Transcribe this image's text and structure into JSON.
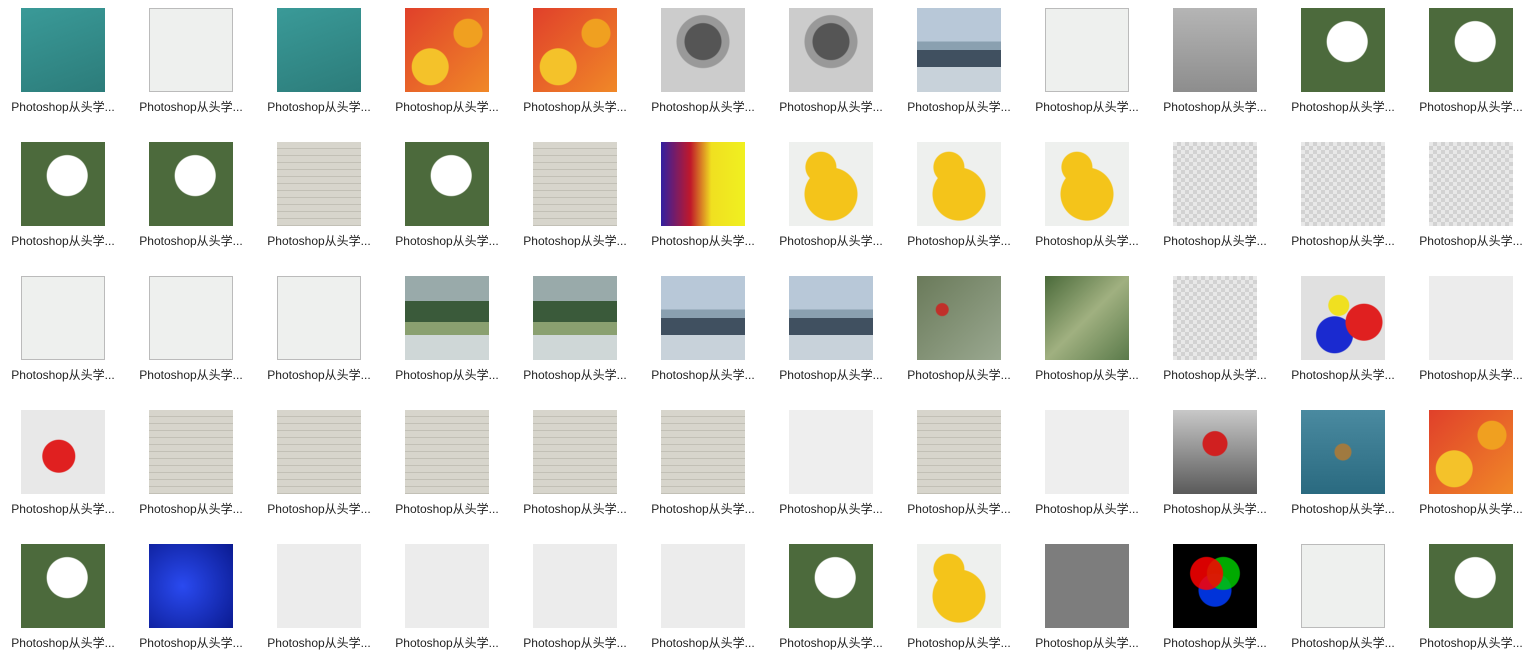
{
  "items": [
    {
      "label": "Photoshop从头学...",
      "thumb": "t-teal"
    },
    {
      "label": "Photoshop从头学...",
      "thumb": "t-white"
    },
    {
      "label": "Photoshop从头学...",
      "thumb": "t-teal"
    },
    {
      "label": "Photoshop从头学...",
      "thumb": "t-flower"
    },
    {
      "label": "Photoshop从头学...",
      "thumb": "t-flower"
    },
    {
      "label": "Photoshop从头学...",
      "thumb": "t-photo"
    },
    {
      "label": "Photoshop从头学...",
      "thumb": "t-photo"
    },
    {
      "label": "Photoshop从头学...",
      "thumb": "t-sea"
    },
    {
      "label": "Photoshop从头学...",
      "thumb": "t-white"
    },
    {
      "label": "Photoshop从头学...",
      "thumb": "t-gray"
    },
    {
      "label": "Photoshop从头学...",
      "thumb": "t-eagle"
    },
    {
      "label": "Photoshop从头学...",
      "thumb": "t-eagle"
    },
    {
      "label": "Photoshop从头学...",
      "thumb": "t-eagle"
    },
    {
      "label": "Photoshop从头学...",
      "thumb": "t-eagle"
    },
    {
      "label": "Photoshop从头学...",
      "thumb": "t-dialog"
    },
    {
      "label": "Photoshop从头学...",
      "thumb": "t-eagle"
    },
    {
      "label": "Photoshop从头学...",
      "thumb": "t-dialog"
    },
    {
      "label": "Photoshop从头学...",
      "thumb": "t-gradient"
    },
    {
      "label": "Photoshop从头学...",
      "thumb": "t-duck"
    },
    {
      "label": "Photoshop从头学...",
      "thumb": "t-duck"
    },
    {
      "label": "Photoshop从头学...",
      "thumb": "t-duck"
    },
    {
      "label": "Photoshop从头学...",
      "thumb": "t-check"
    },
    {
      "label": "Photoshop从头学...",
      "thumb": "t-check"
    },
    {
      "label": "Photoshop从头学...",
      "thumb": "t-check"
    },
    {
      "label": "Photoshop从头学...",
      "thumb": "t-white"
    },
    {
      "label": "Photoshop从头学...",
      "thumb": "t-white"
    },
    {
      "label": "Photoshop从头学...",
      "thumb": "t-white"
    },
    {
      "label": "Photoshop从头学...",
      "thumb": "t-land"
    },
    {
      "label": "Photoshop从头学...",
      "thumb": "t-land"
    },
    {
      "label": "Photoshop从头学...",
      "thumb": "t-sea"
    },
    {
      "label": "Photoshop从头学...",
      "thumb": "t-sea"
    },
    {
      "label": "Photoshop从头学...",
      "thumb": "t-leaf"
    },
    {
      "label": "Photoshop从头学...",
      "thumb": "t-green"
    },
    {
      "label": "Photoshop从头学...",
      "thumb": "t-check"
    },
    {
      "label": "Photoshop从头学...",
      "thumb": "t-shapes"
    },
    {
      "label": "Photoshop从头学...",
      "thumb": "t-plain"
    },
    {
      "label": "Photoshop从头学...",
      "thumb": "t-cat"
    },
    {
      "label": "Photoshop从头学...",
      "thumb": "t-dialog"
    },
    {
      "label": "Photoshop从头学...",
      "thumb": "t-dialog"
    },
    {
      "label": "Photoshop从头学...",
      "thumb": "t-dialog"
    },
    {
      "label": "Photoshop从头学...",
      "thumb": "t-dialog"
    },
    {
      "label": "Photoshop从头学...",
      "thumb": "t-dialog"
    },
    {
      "label": "Photoshop从头学...",
      "thumb": "t-psmov"
    },
    {
      "label": "Photoshop从头学...",
      "thumb": "t-dialog"
    },
    {
      "label": "Photoshop从头学...",
      "thumb": "t-psmov"
    },
    {
      "label": "Photoshop从头学...",
      "thumb": "t-rose"
    },
    {
      "label": "Photoshop从头学...",
      "thumb": "t-dragonfly"
    },
    {
      "label": "Photoshop从头学...",
      "thumb": "t-flower"
    },
    {
      "label": "Photoshop从头学...",
      "thumb": "t-eagle"
    },
    {
      "label": "Photoshop从头学...",
      "thumb": "t-blue"
    },
    {
      "label": "Photoshop从头学...",
      "thumb": "t-plain"
    },
    {
      "label": "Photoshop从头学...",
      "thumb": "t-plain"
    },
    {
      "label": "Photoshop从头学...",
      "thumb": "t-plain"
    },
    {
      "label": "Photoshop从头学...",
      "thumb": "t-plain"
    },
    {
      "label": "Photoshop从头学...",
      "thumb": "t-eagle"
    },
    {
      "label": "Photoshop从头学...",
      "thumb": "t-duck"
    },
    {
      "label": "Photoshop从头学...",
      "thumb": "t-darkgray"
    },
    {
      "label": "Photoshop从头学...",
      "thumb": "t-rgb"
    },
    {
      "label": "Photoshop从头学...",
      "thumb": "t-white"
    },
    {
      "label": "Photoshop从头学...",
      "thumb": "t-eagle"
    }
  ]
}
